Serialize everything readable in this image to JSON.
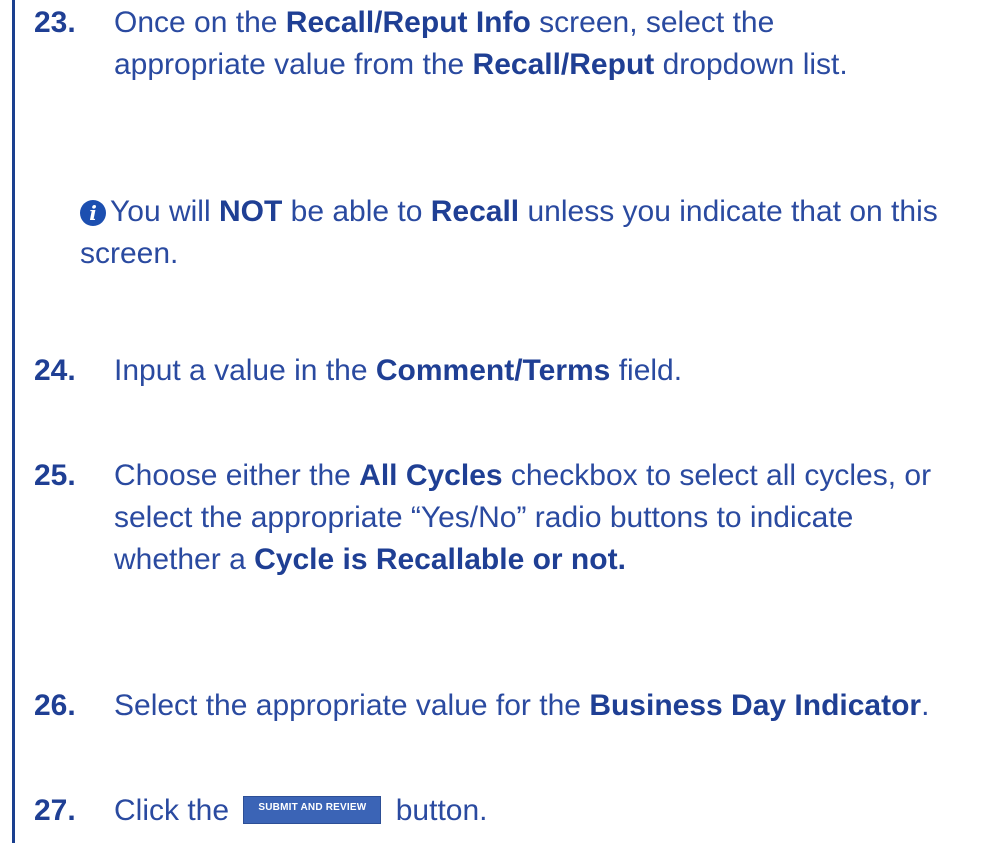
{
  "steps": [
    {
      "number": "23.",
      "parts": [
        "Once on the ",
        "Recall/Reput Info",
        " screen, select the appropriate value from the ",
        "Recall/Reput",
        " dropdown list."
      ]
    },
    {
      "number": "24.",
      "parts": [
        "Input a value in the ",
        "Comment/Terms",
        " field."
      ]
    },
    {
      "number": "25.",
      "parts": [
        "Choose either the ",
        "All Cycles",
        " checkbox to select all cycles, or select the appropriate “Yes/No” radio buttons to indicate whether a ",
        "Cycle is Recallable or  not."
      ]
    },
    {
      "number": "26.",
      "parts": [
        "Select the appropriate value for the ",
        "Business Day Indicator",
        "."
      ]
    },
    {
      "number": "27.",
      "parts": [
        "Click the ",
        " button."
      ]
    }
  ],
  "note": {
    "icon": "info-icon",
    "parts": [
      "You will ",
      "NOT",
      " be able to ",
      "Recall",
      " unless you indicate that on this screen."
    ]
  },
  "submit_button": {
    "label": "SUBMIT AND REVIEW"
  },
  "colors": {
    "text": "#2a4aa0",
    "bold": "#1f3f94",
    "rule": "#1a3f8f",
    "button": "#3b64b6"
  }
}
